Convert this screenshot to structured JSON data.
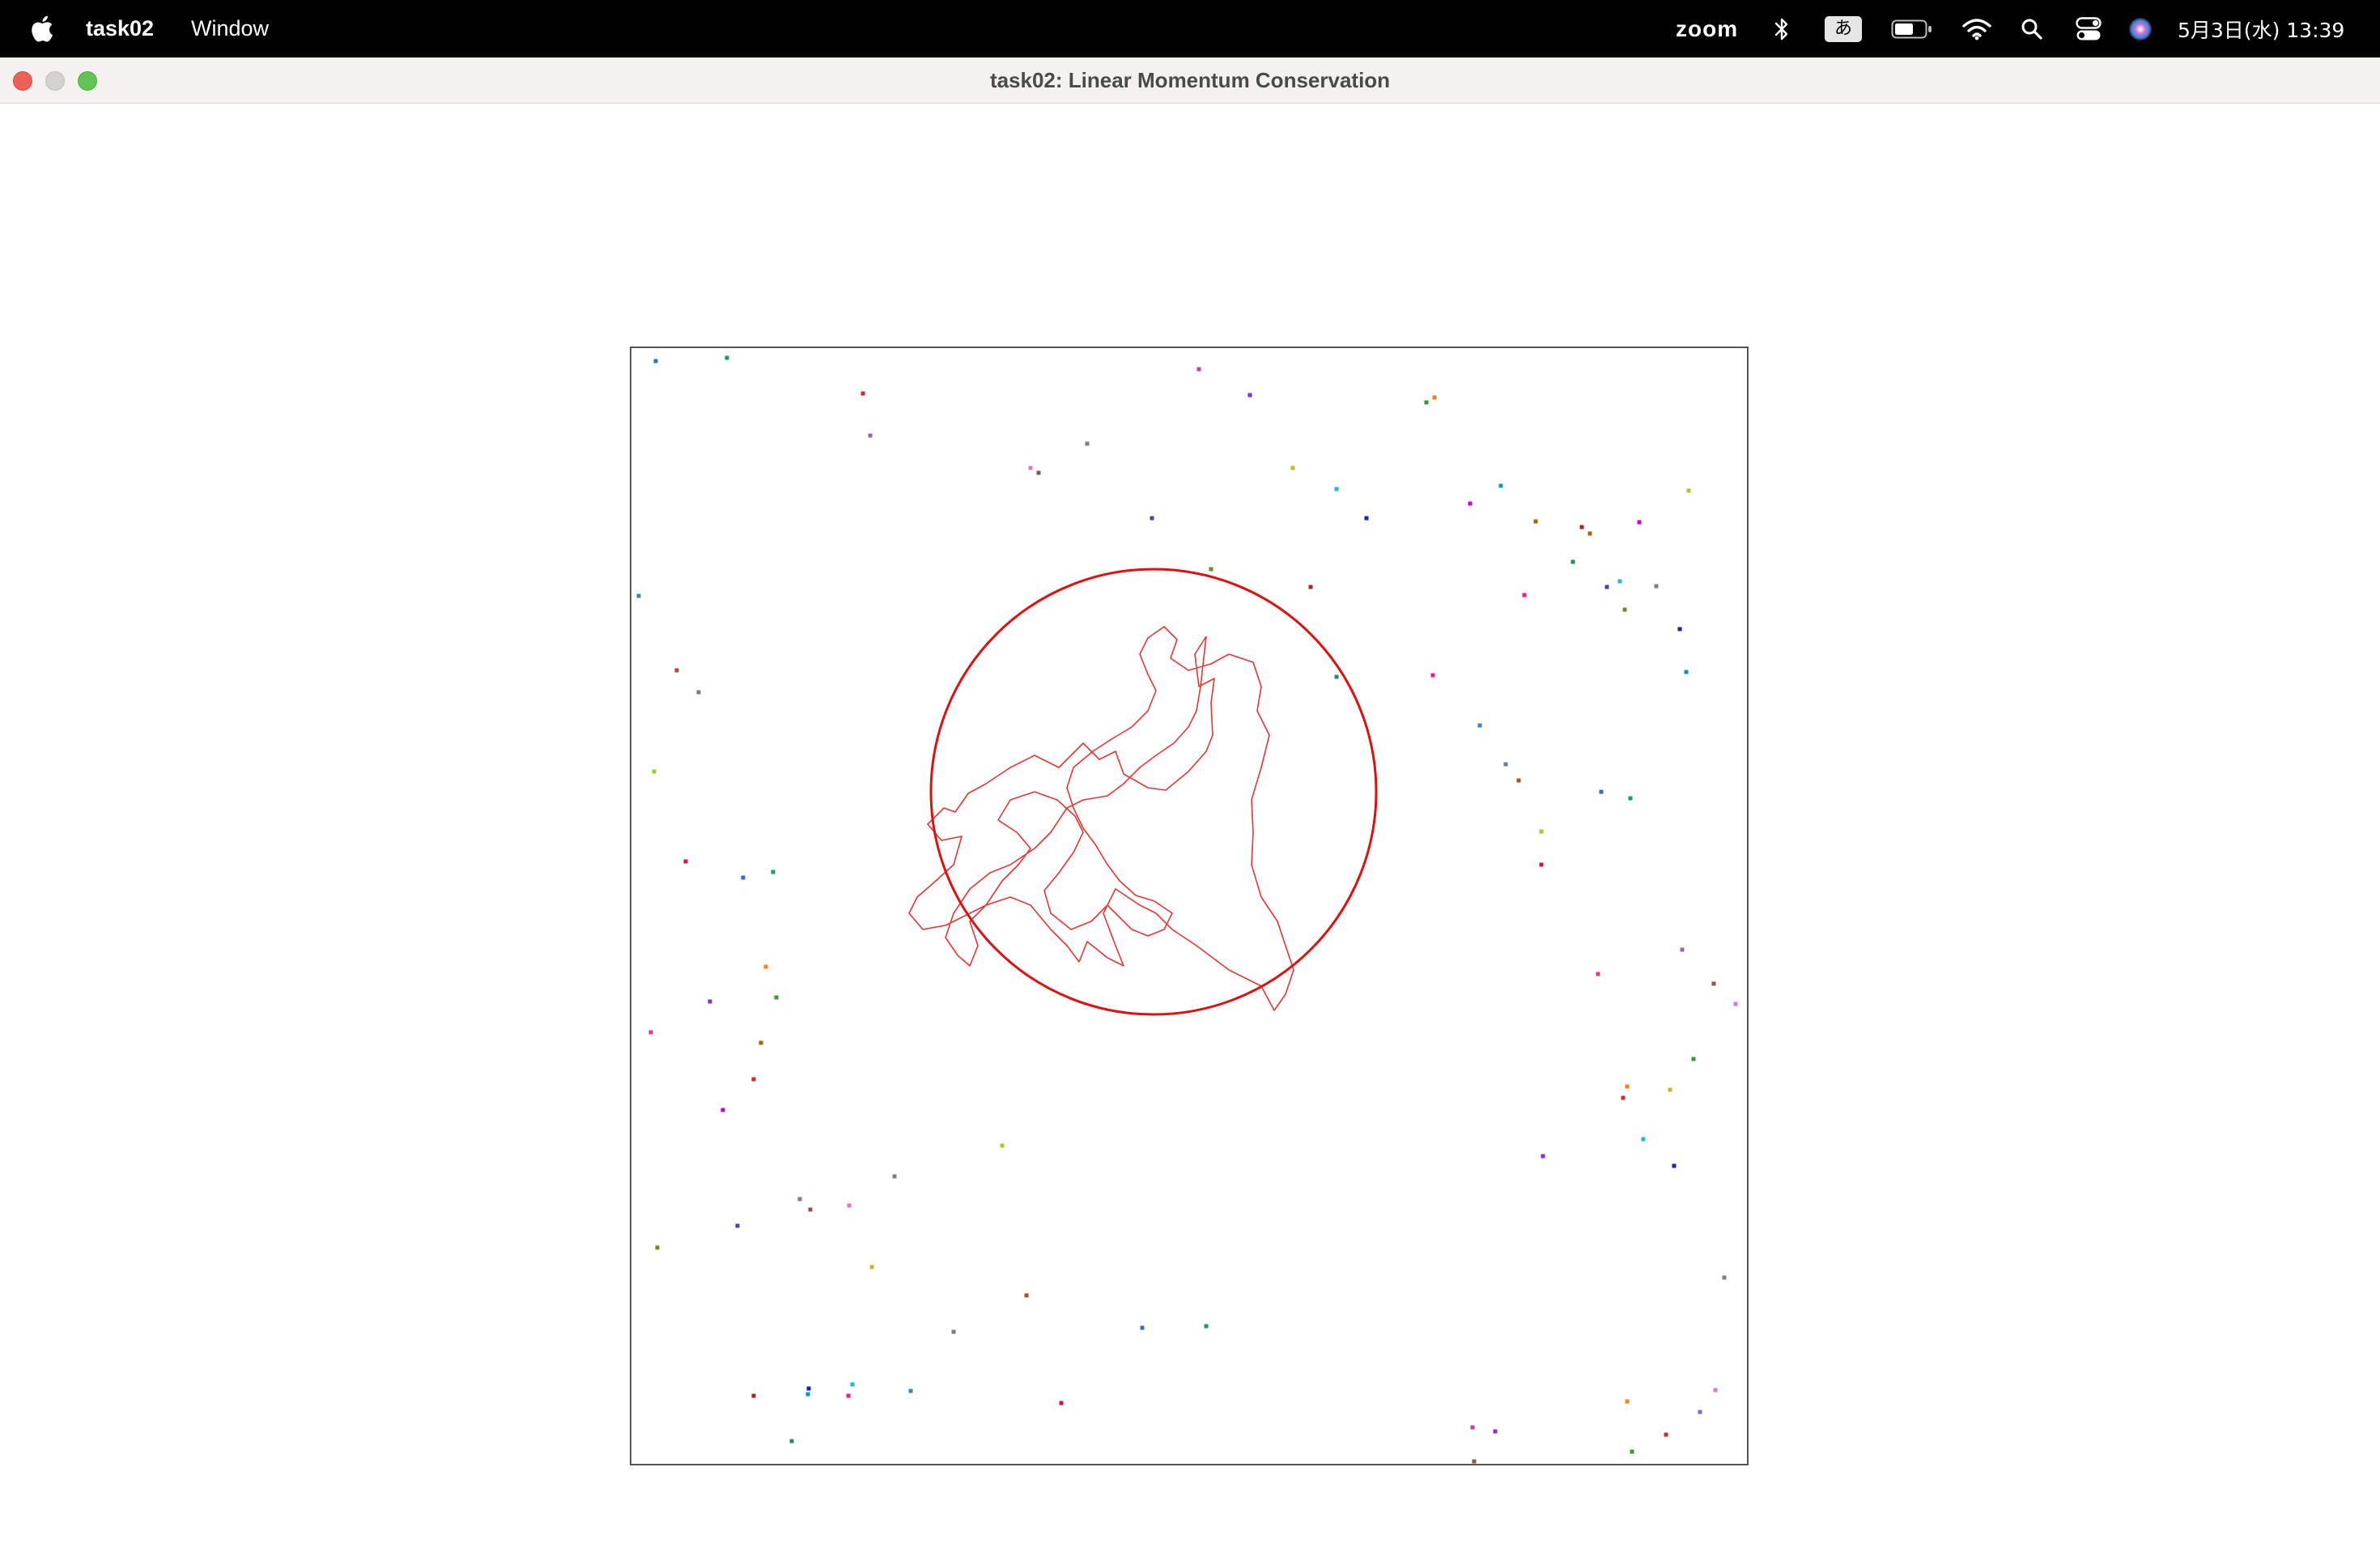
{
  "menubar": {
    "apple_icon": "apple-logo-icon",
    "app_name": "task02",
    "menus": [
      "Window"
    ],
    "status": {
      "zoom": "zoom",
      "ime": "あ",
      "date_time": "5月3日(水) 13:39"
    }
  },
  "window": {
    "title": "task02: Linear Momentum Conservation",
    "buttons": [
      "close",
      "minimize",
      "zoom"
    ]
  },
  "simulation": {
    "box_color": "#555555",
    "big_circle_color": "#e01010",
    "trail_color": "#ee3333",
    "particle_count": 95
  }
}
